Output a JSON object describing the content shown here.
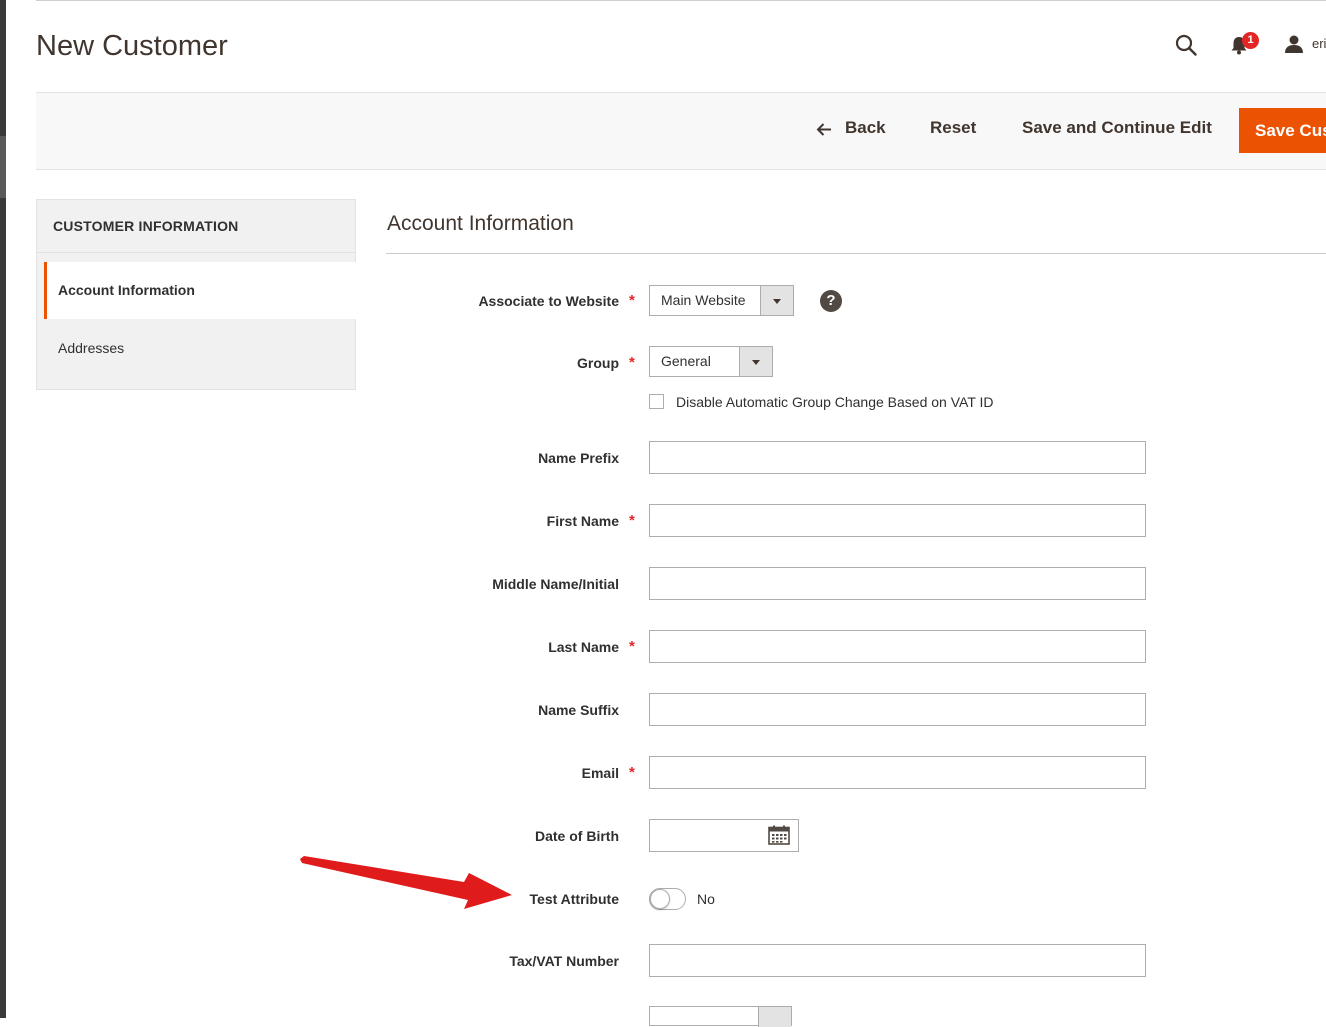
{
  "header": {
    "title": "New Customer",
    "notification_count": "1",
    "user_name": "eri"
  },
  "actions": {
    "back_label": "Back",
    "reset_label": "Reset",
    "save_continue_label": "Save and Continue Edit",
    "save_label": "Save Cus"
  },
  "sidebar": {
    "heading": "CUSTOMER INFORMATION",
    "items": [
      {
        "label": "Account Information",
        "active": true
      },
      {
        "label": "Addresses",
        "active": false
      }
    ]
  },
  "section": {
    "title": "Account Information"
  },
  "form": {
    "website": {
      "label": "Associate to Website",
      "value": "Main Website",
      "required": true
    },
    "group": {
      "label": "Group",
      "value": "General",
      "required": true
    },
    "disable_group_change": {
      "label": "Disable Automatic Group Change Based on VAT ID",
      "checked": false
    },
    "name_prefix": {
      "label": "Name Prefix",
      "value": ""
    },
    "first_name": {
      "label": "First Name",
      "value": "",
      "required": true
    },
    "middle_name": {
      "label": "Middle Name/Initial",
      "value": ""
    },
    "last_name": {
      "label": "Last Name",
      "value": "",
      "required": true
    },
    "name_suffix": {
      "label": "Name Suffix",
      "value": ""
    },
    "email": {
      "label": "Email",
      "value": "",
      "required": true
    },
    "dob": {
      "label": "Date of Birth",
      "value": ""
    },
    "test_attribute": {
      "label": "Test Attribute",
      "state": "No"
    },
    "taxvat": {
      "label": "Tax/VAT Number",
      "value": ""
    }
  },
  "required_mark": "*",
  "help_glyph": "?",
  "colors": {
    "accent": "#eb5202",
    "required": "#e22626",
    "annotation_arrow": "#e01b1b"
  }
}
